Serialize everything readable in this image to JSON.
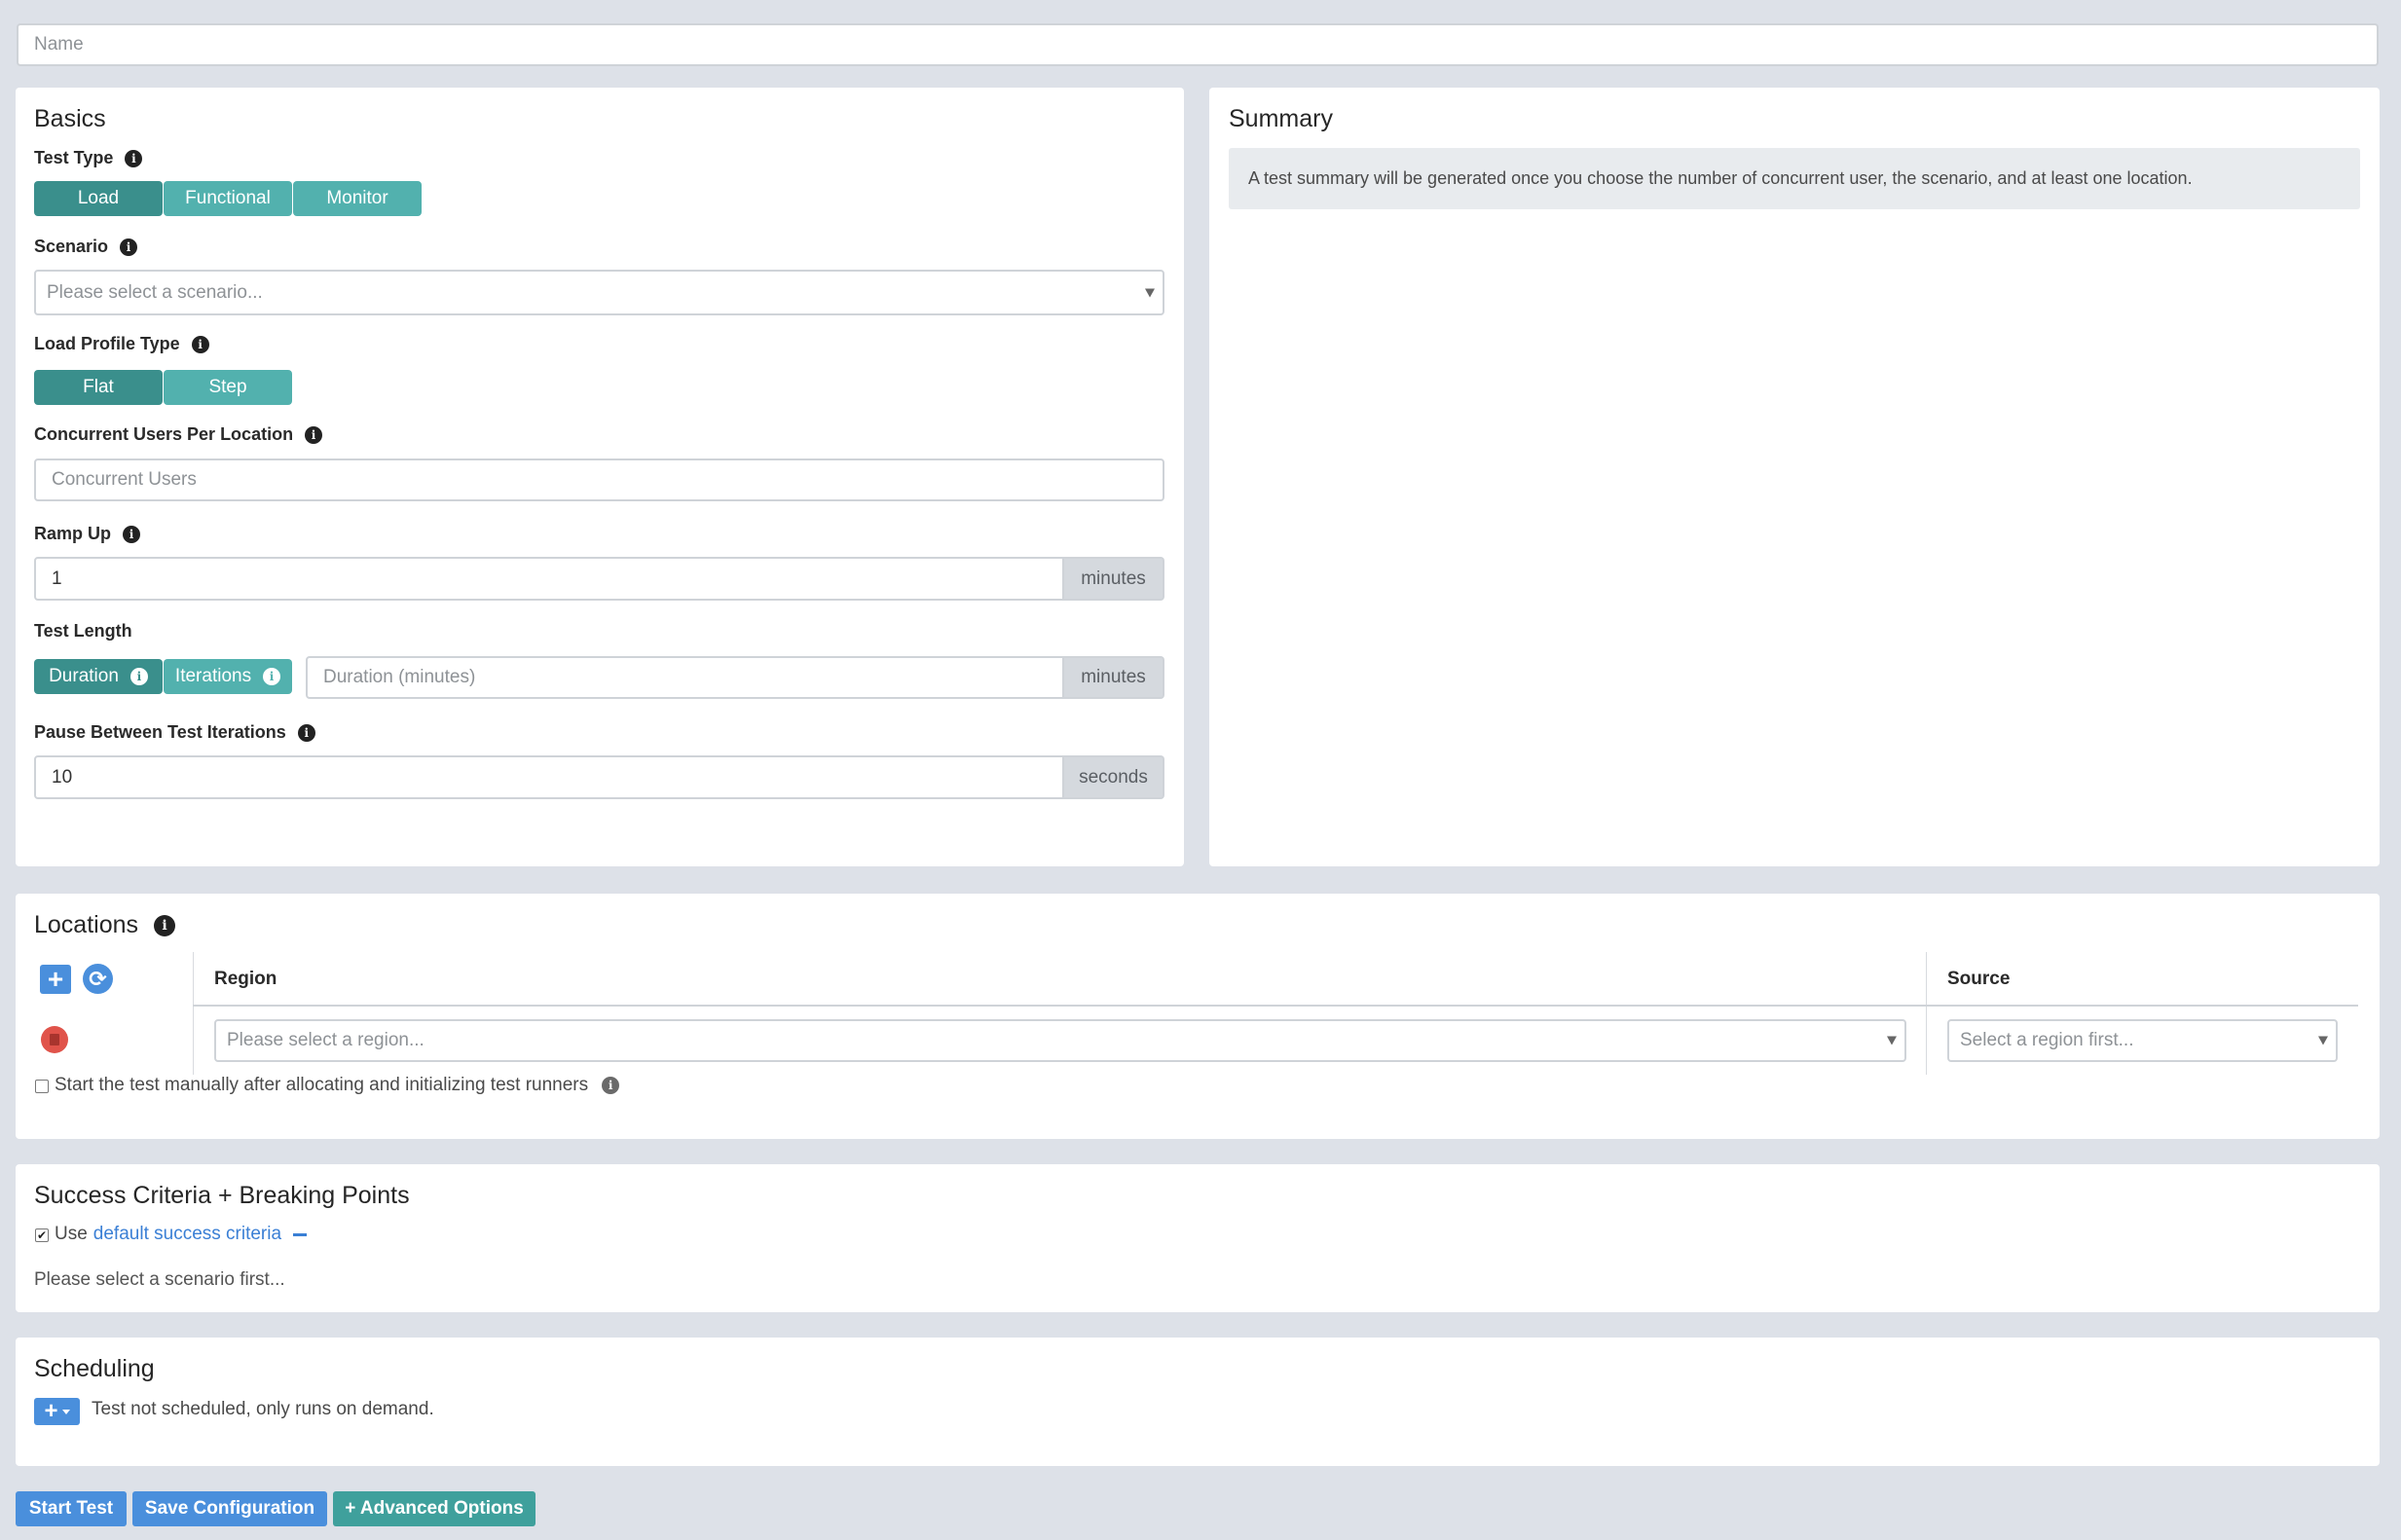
{
  "name_field": {
    "placeholder": "Name"
  },
  "basics": {
    "title": "Basics",
    "test_type": {
      "label": "Test Type",
      "options": [
        "Load",
        "Functional",
        "Monitor"
      ],
      "selected": "Load"
    },
    "scenario": {
      "label": "Scenario",
      "placeholder": "Please select a scenario..."
    },
    "load_profile": {
      "label": "Load Profile Type",
      "options": [
        "Flat",
        "Step"
      ],
      "selected": "Flat"
    },
    "concurrent_users": {
      "label": "Concurrent Users Per Location",
      "placeholder": "Concurrent Users"
    },
    "ramp_up": {
      "label": "Ramp Up",
      "value": "1",
      "unit": "minutes"
    },
    "test_length": {
      "label": "Test Length",
      "options": [
        "Duration",
        "Iterations"
      ],
      "selected": "Duration",
      "placeholder": "Duration (minutes)",
      "unit": "minutes"
    },
    "pause": {
      "label": "Pause Between Test Iterations",
      "value": "10",
      "unit": "seconds"
    }
  },
  "summary": {
    "title": "Summary",
    "message": "A test summary will be generated once you choose the number of concurrent user, the scenario, and at least one location."
  },
  "locations": {
    "title": "Locations",
    "columns": {
      "region": "Region",
      "source": "Source"
    },
    "region_placeholder": "Please select a region...",
    "source_placeholder": "Select a region first...",
    "manual_start_label": "Start the test manually after allocating and initializing test runners"
  },
  "success": {
    "title": "Success Criteria + Breaking Points",
    "use_prefix": "Use",
    "link": "default success criteria",
    "note": "Please select a scenario first..."
  },
  "scheduling": {
    "title": "Scheduling",
    "add_label": "+",
    "status": "Test not scheduled, only runs on demand."
  },
  "footer": {
    "start": "Start Test",
    "save": "Save Configuration",
    "advanced": "+ Advanced Options"
  },
  "colors": {
    "teal": "#52b1ae",
    "teal_active": "#3a8f8c",
    "blue": "#4a8fdc",
    "delete": "#e0534a",
    "background": "#dde1e8"
  }
}
